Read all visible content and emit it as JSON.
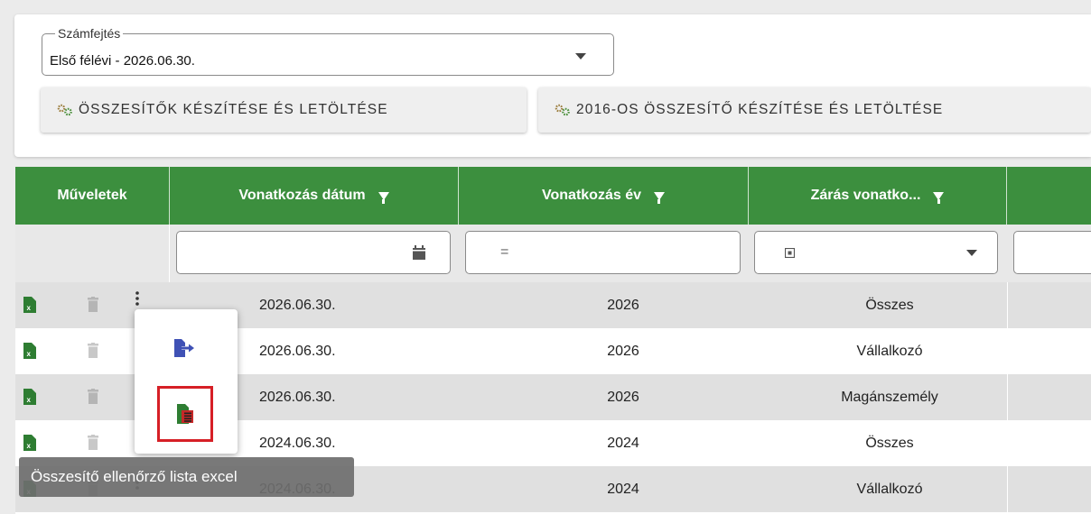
{
  "form": {
    "select_label": "Számfejtés",
    "select_value": "Első félévi - 2026.06.30.",
    "button1_label": "ÖSSZESÍTŐK KÉSZÍTÉSE ÉS LETÖLTÉSE",
    "button2_label": "2016-OS ÖSSZESÍTŐ KÉSZÍTÉSE ÉS LETÖLTÉSE"
  },
  "table": {
    "columns": [
      "Műveletek",
      "Vonatkozás dátum",
      "Vonatkozás év",
      "Zárás vonatko..."
    ],
    "filters": {
      "year_operator": "="
    },
    "rows": [
      {
        "date": "2026.06.30.",
        "year": "2026",
        "zaras": "Összes"
      },
      {
        "date": "2026.06.30.",
        "year": "2026",
        "zaras": "Vállalkozó"
      },
      {
        "date": "2026.06.30.",
        "year": "2026",
        "zaras": "Magánszemély"
      },
      {
        "date": "2024.06.30.",
        "year": "2024",
        "zaras": "Összes"
      },
      {
        "date": "2024.06.30.",
        "year": "2024",
        "zaras": "Vállalkozó"
      }
    ]
  },
  "tooltip": {
    "text": "Összesítő ellenőrző lista excel"
  },
  "icons": {
    "excel": "excel-file-icon",
    "delete": "trash-icon",
    "more": "more-vertical-icon",
    "export": "file-export-icon",
    "checklist": "excel-list-icon",
    "calendar": "calendar-icon",
    "gear": "gears-icon"
  },
  "colors": {
    "header_green": "#3c8f3e",
    "excel_green": "#2e7d32",
    "highlight_red": "#d61f26",
    "export_blue": "#3f51b5"
  }
}
